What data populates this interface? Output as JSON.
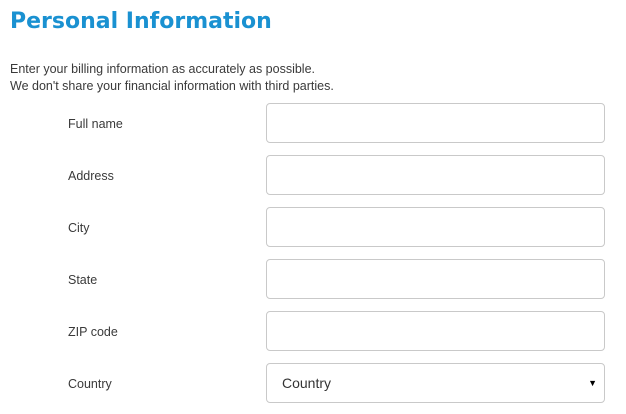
{
  "header": {
    "title": "Personal Information"
  },
  "intro": {
    "line1": "Enter your billing information as accurately as possible.",
    "line2": "We don't share your financial information with third parties."
  },
  "form": {
    "fields": [
      {
        "label": "Full name",
        "value": ""
      },
      {
        "label": "Address",
        "value": ""
      },
      {
        "label": "City",
        "value": ""
      },
      {
        "label": "State",
        "value": ""
      },
      {
        "label": "ZIP code",
        "value": ""
      }
    ],
    "country": {
      "label": "Country",
      "selected": "Country"
    }
  },
  "icons": {
    "dropdown": "chevron-down-icon"
  },
  "colors": {
    "title": "#1a91d1",
    "input_border": "#c9c9c9",
    "text": "#3a3a3a"
  }
}
